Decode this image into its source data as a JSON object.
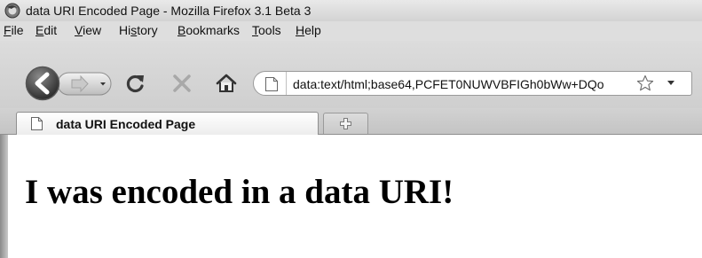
{
  "window": {
    "title": "data URI Encoded Page - Mozilla Firefox 3.1 Beta 3"
  },
  "menu": {
    "items": [
      {
        "first": "F",
        "rest": "ile"
      },
      {
        "first": "E",
        "rest": "dit"
      },
      {
        "first": "V",
        "rest": "iew"
      },
      {
        "pre": "Hi",
        "first": "s",
        "rest": "tory"
      },
      {
        "first": "B",
        "rest": "ookmarks"
      },
      {
        "first": "T",
        "rest": "ools"
      },
      {
        "first": "H",
        "rest": "elp"
      }
    ]
  },
  "navbar": {
    "icons": [
      "back-icon",
      "forward-icon",
      "dropdown-icon",
      "reload-icon",
      "stop-icon",
      "home-icon"
    ],
    "url": "data:text/html;base64,PCFET0NUWVBFIGh0bWw+DQo"
  },
  "tabs": {
    "active_label": "data URI Encoded Page"
  },
  "content": {
    "heading": "I was encoded in a data URI!"
  },
  "colors": {
    "chrome": "#d6d6d6",
    "content_bg": "#ffffff",
    "text": "#000000"
  }
}
